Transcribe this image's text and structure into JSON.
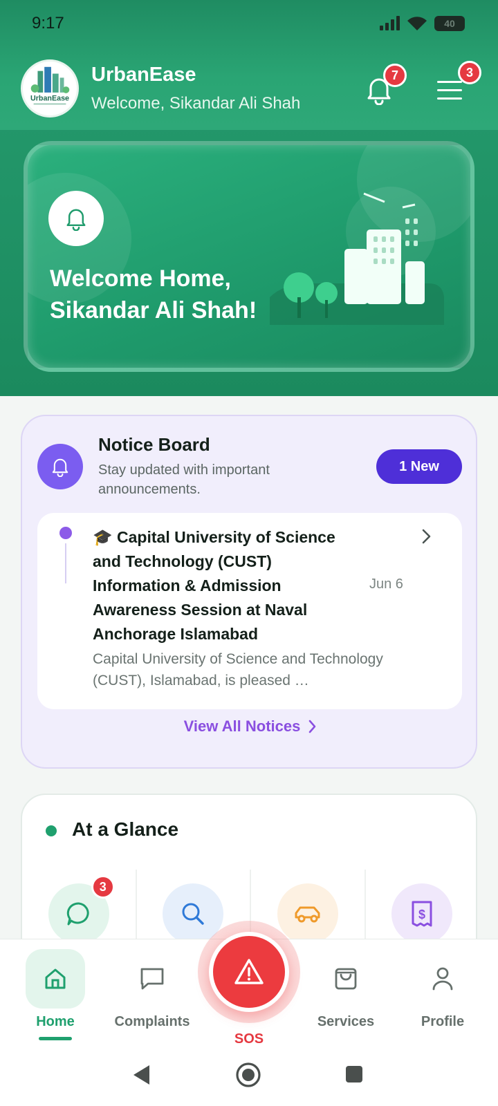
{
  "status_bar": {
    "time": "9:17",
    "battery": "40"
  },
  "header": {
    "app_name": "UrbanEase",
    "welcome": "Welcome, Sikandar Ali Shah",
    "logo_text": "UrbanEase",
    "notifications_count": "7",
    "menu_count": "3"
  },
  "hero": {
    "line1": "Welcome Home,",
    "line2": "Sikandar Ali Shah!"
  },
  "notice_board": {
    "title": "Notice Board",
    "subtitle": "Stay updated with important announcements.",
    "new_badge": "1 New",
    "item": {
      "emoji": "🎓",
      "title": "Capital University of Science and Technology (CUST) Information & Admission Awareness Session at Naval Anchorage Islamabad",
      "date": "Jun 6",
      "excerpt": "Capital University of Science and Technology (CUST), Islamabad, is pleased …"
    },
    "view_all": "View All Notices"
  },
  "glance": {
    "title": "At a Glance",
    "cells": [
      {
        "icon": "chat-icon",
        "badge": "3",
        "bg": "#e3f5ec",
        "color": "#1fa06e"
      },
      {
        "icon": "search-icon",
        "bg": "#e6effb",
        "color": "#2f7ad8"
      },
      {
        "icon": "car-icon",
        "bg": "#fdf1e2",
        "color": "#ef9a2b"
      },
      {
        "icon": "receipt-icon",
        "bg": "#f0e8fb",
        "color": "#8a4fe0"
      }
    ]
  },
  "bottom_nav": {
    "home": "Home",
    "complaints": "Complaints",
    "sos": "SOS",
    "services": "Services",
    "profile": "Profile"
  },
  "colors": {
    "brand_green": "#1fa06e",
    "notice_purple": "#4e2fd8",
    "alert_red": "#ec3b3f"
  }
}
